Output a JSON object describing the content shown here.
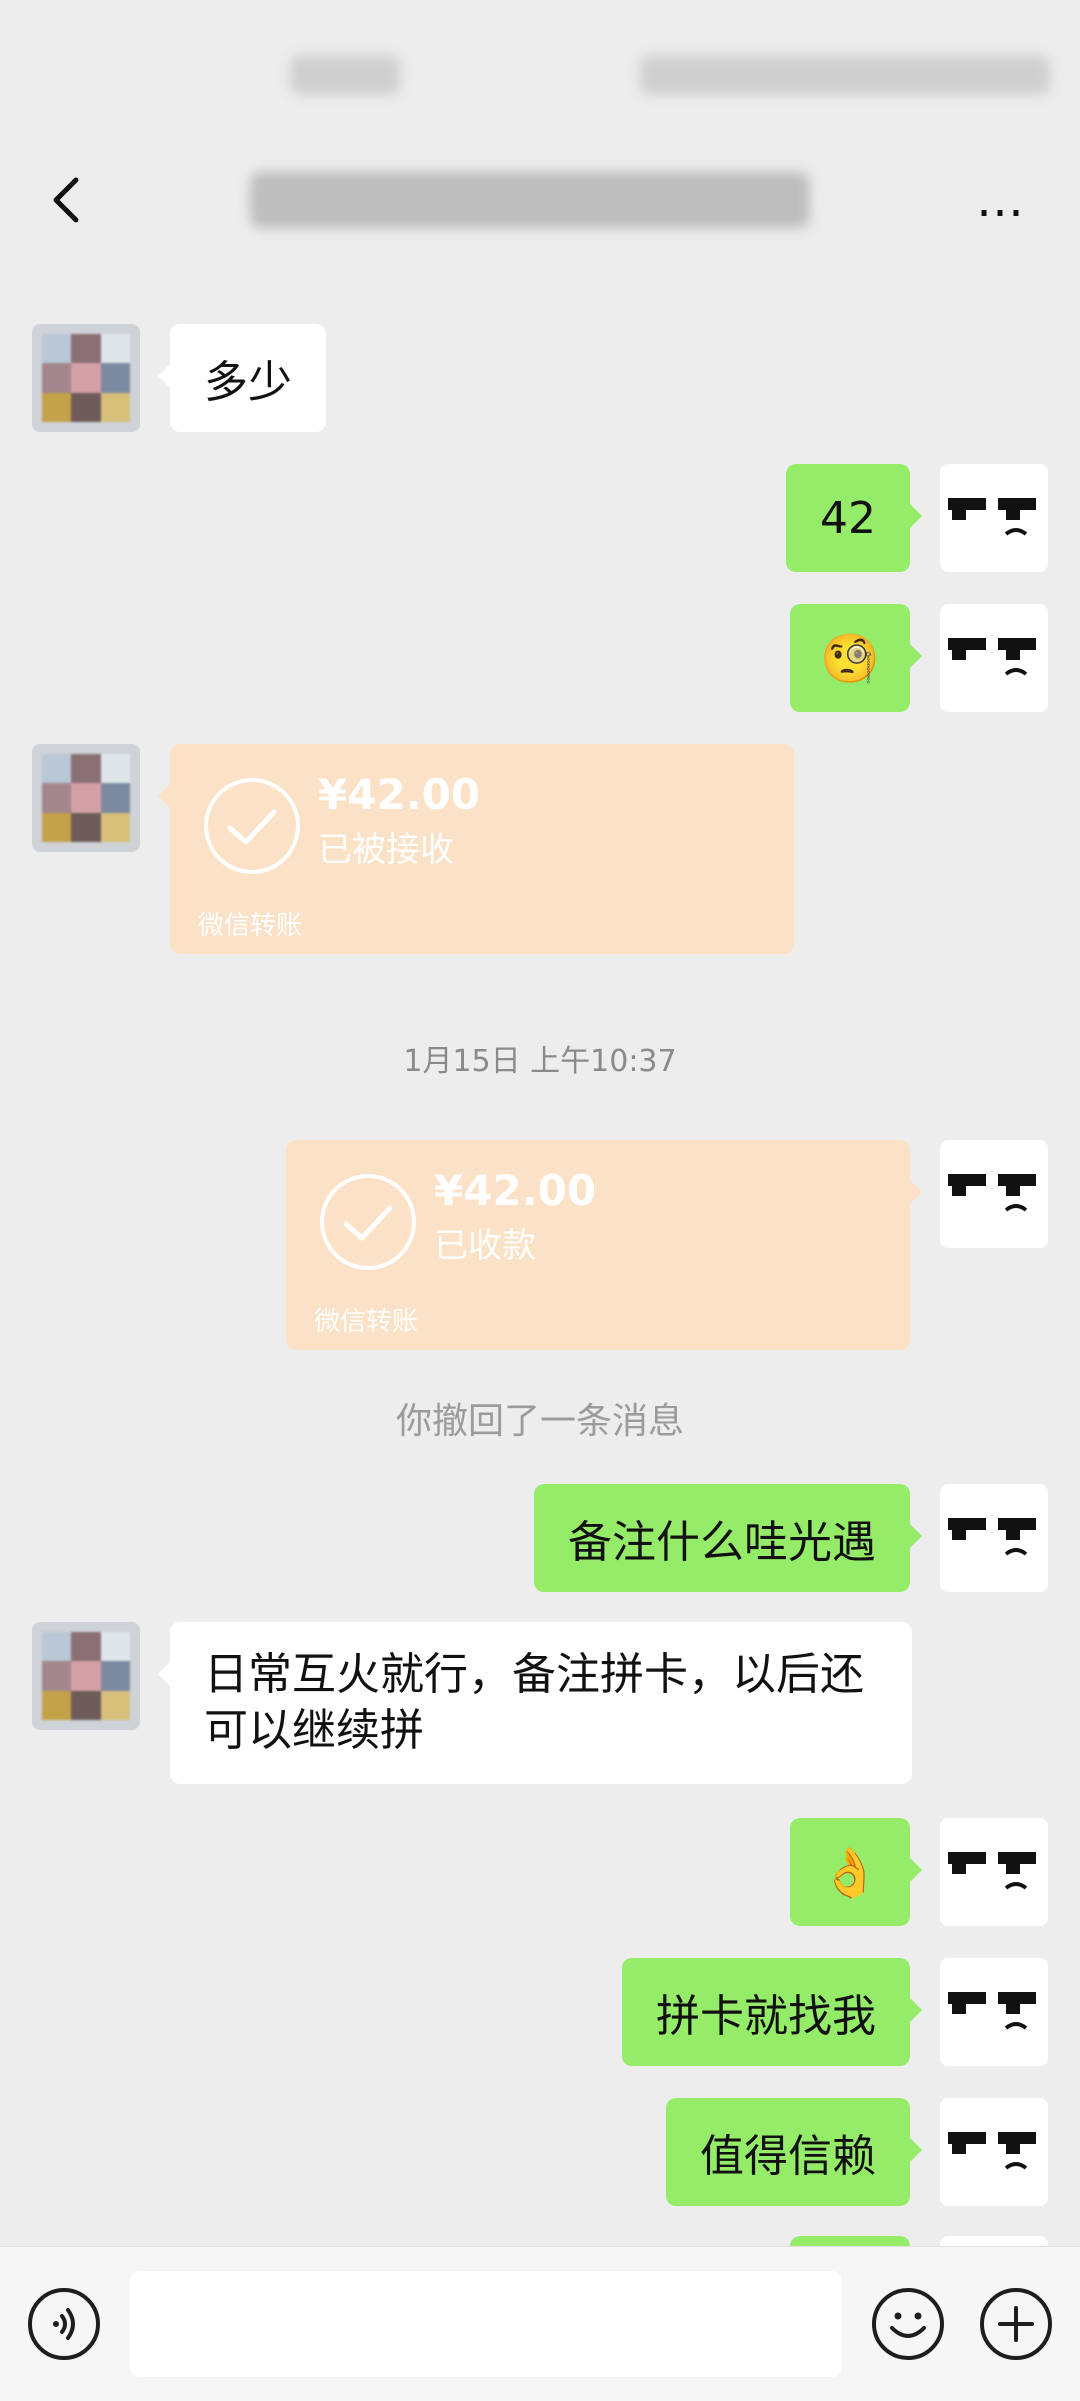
{
  "status_bar": {
    "time": "",
    "indicators": ""
  },
  "header": {
    "title": "",
    "back_icon": "chevron-left-icon",
    "more_label": "…"
  },
  "messages": [
    {
      "side": "left",
      "type": "text",
      "text": "多少"
    },
    {
      "side": "right",
      "type": "text",
      "text": "42"
    },
    {
      "side": "right",
      "type": "emoji",
      "emoji": "🧐"
    },
    {
      "side": "left",
      "type": "transfer",
      "amount": "¥42.00",
      "status": "已被接收",
      "footer": "微信转账"
    },
    {
      "type": "time",
      "text": "1月15日 上午10:37"
    },
    {
      "side": "right",
      "type": "transfer",
      "amount": "¥42.00",
      "status": "已收款",
      "footer": "微信转账"
    },
    {
      "type": "system",
      "text": "你撤回了一条消息"
    },
    {
      "side": "right",
      "type": "text",
      "text": "备注什么哇光遇"
    },
    {
      "side": "left",
      "type": "text",
      "text": "日常互火就行，备注拼卡，以后还可以继续拼"
    },
    {
      "side": "right",
      "type": "emoji",
      "emoji": "👌"
    },
    {
      "side": "right",
      "type": "text",
      "text": "拼卡就找我"
    },
    {
      "side": "right",
      "type": "text",
      "text": "值得信赖"
    }
  ],
  "input_bar": {
    "voice_icon": "voice-icon",
    "emoji_icon": "smiley-icon",
    "plus_icon": "plus-icon",
    "value": ""
  },
  "colors": {
    "bg": "#ededed",
    "green_bubble": "#95ec69",
    "transfer": "#fbe1c5"
  }
}
